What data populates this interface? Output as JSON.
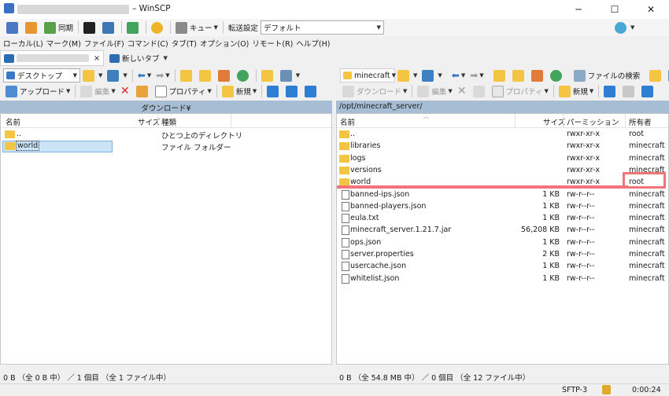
{
  "window": {
    "title": "– WinSCP",
    "minimize": "─",
    "maximize": "☐",
    "close": "✕"
  },
  "toolbar1": {
    "sync": "同期",
    "queue": "キュー",
    "transfer_label": "転送設定",
    "transfer_value": "デフォルト"
  },
  "menu": [
    "ローカル(L)",
    "マーク(M)",
    "ファイル(F)",
    "コマンド(C)",
    "タブ(T)",
    "オプション(O)",
    "リモート(R)",
    "ヘルプ(H)"
  ],
  "tabs": {
    "new_tab": "新しいタブ",
    "close": "×"
  },
  "left": {
    "location": "デスクトップ",
    "upload": "アップロード",
    "edit": "編集",
    "properties": "プロパティ",
    "new": "新規",
    "path": "ダウンロード¥",
    "columns": {
      "name": "名前",
      "size": "サイズ",
      "type": "種類"
    },
    "rows": [
      {
        "name": "..",
        "size": "",
        "type": "ひとつ上のディレクトリ"
      },
      {
        "name": "world",
        "size": "",
        "type": "ファイル フォルダー"
      }
    ],
    "status": "0 B （全 0 B 中） ／ 1 個目 （全 1 ファイル中）"
  },
  "right": {
    "location": "minecraft",
    "download": "ダウンロード",
    "edit": "編集",
    "properties": "プロパティ",
    "new": "新規",
    "find": "ファイルの検索",
    "path": "/opt/minecraft_server/",
    "columns": {
      "name": "名前",
      "size": "サイズ",
      "perm": "パーミッション",
      "owner": "所有者"
    },
    "rows": [
      {
        "kind": "up",
        "name": "..",
        "size": "",
        "perm": "rwxr-xr-x",
        "owner": "root"
      },
      {
        "kind": "folder",
        "name": "libraries",
        "size": "",
        "perm": "rwxr-xr-x",
        "owner": "minecraft"
      },
      {
        "kind": "folder",
        "name": "logs",
        "size": "",
        "perm": "rwxr-xr-x",
        "owner": "minecraft"
      },
      {
        "kind": "folder",
        "name": "versions",
        "size": "",
        "perm": "rwxr-xr-x",
        "owner": "minecraft"
      },
      {
        "kind": "folder",
        "name": "world",
        "size": "",
        "perm": "rwxr-xr-x",
        "owner": "root"
      },
      {
        "kind": "file",
        "name": "banned-ips.json",
        "size": "1 KB",
        "perm": "rw-r--r--",
        "owner": "minecraft"
      },
      {
        "kind": "file",
        "name": "banned-players.json",
        "size": "1 KB",
        "perm": "rw-r--r--",
        "owner": "minecraft"
      },
      {
        "kind": "file",
        "name": "eula.txt",
        "size": "1 KB",
        "perm": "rw-r--r--",
        "owner": "minecraft"
      },
      {
        "kind": "file",
        "name": "minecraft_server.1.21.7.jar",
        "size": "56,208 KB",
        "perm": "rw-r--r--",
        "owner": "minecraft"
      },
      {
        "kind": "file",
        "name": "ops.json",
        "size": "1 KB",
        "perm": "rw-r--r--",
        "owner": "minecraft"
      },
      {
        "kind": "file",
        "name": "server.properties",
        "size": "2 KB",
        "perm": "rw-r--r--",
        "owner": "minecraft"
      },
      {
        "kind": "file",
        "name": "usercache.json",
        "size": "1 KB",
        "perm": "rw-r--r--",
        "owner": "minecraft"
      },
      {
        "kind": "file",
        "name": "whitelist.json",
        "size": "1 KB",
        "perm": "rw-r--r--",
        "owner": "minecraft"
      }
    ],
    "status": "0 B （全 54.8 MB 中） ／ 0 個目 （全 12 ファイル中）"
  },
  "statusbar": {
    "protocol": "SFTP-3",
    "time": "0:00:24"
  },
  "colors": {
    "path_bar": "#a7bdd3",
    "highlight": "#f2737a",
    "folder": "#f4c542",
    "selection": "#cce4f7"
  }
}
